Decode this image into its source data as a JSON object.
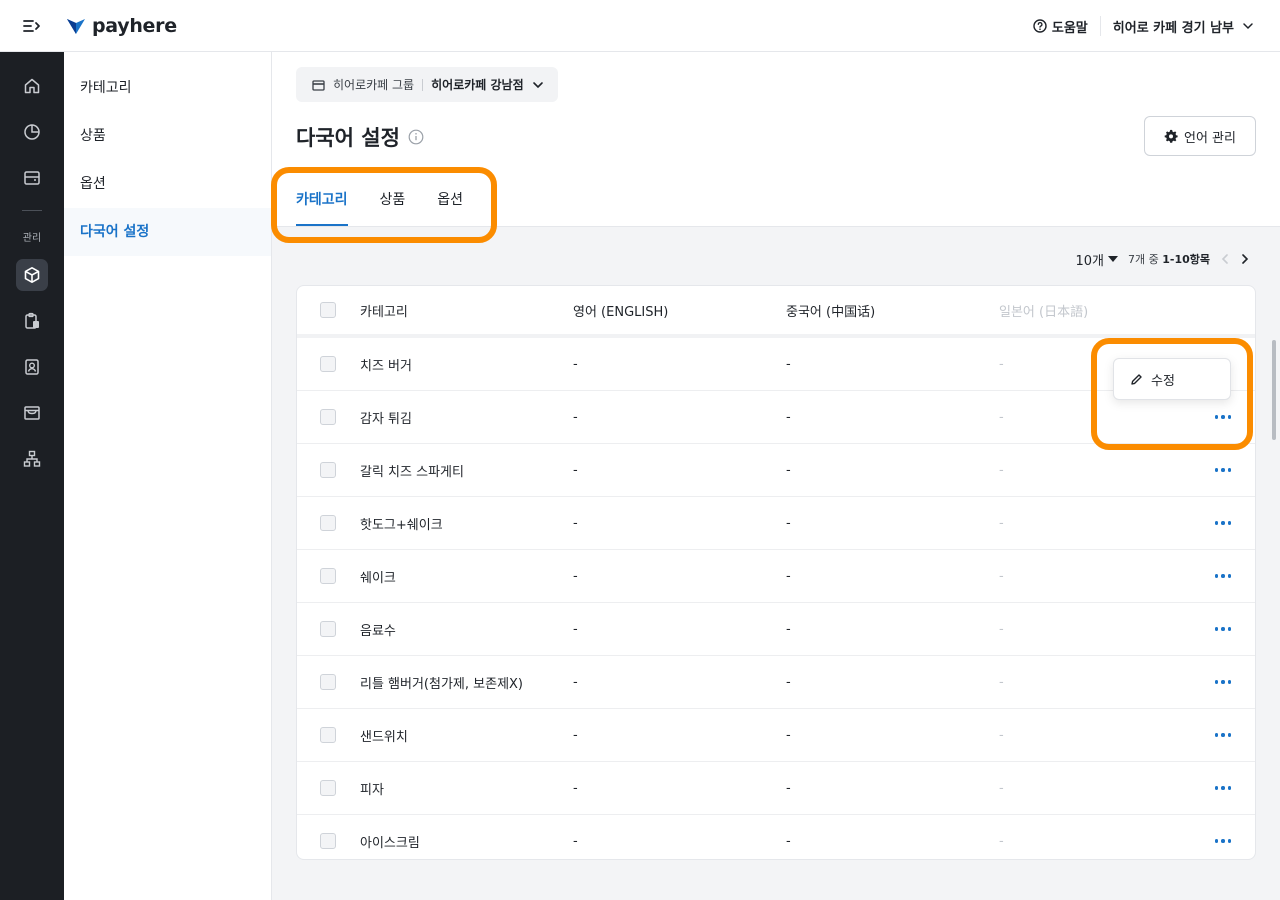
{
  "topbar": {
    "brand": "payhere",
    "help_label": "도움말",
    "store_label": "히어로 카페 경기 남부"
  },
  "rail": {
    "section_label": "관리"
  },
  "subnav": {
    "items": [
      {
        "label": "카테고리"
      },
      {
        "label": "상품"
      },
      {
        "label": "옵션"
      },
      {
        "label": "다국어 설정"
      }
    ]
  },
  "header": {
    "group": "히어로카페 그룹",
    "store": "히어로카페 강남점",
    "title": "다국어 설정",
    "lang_button": "언어 관리",
    "tabs": [
      {
        "label": "카테고리"
      },
      {
        "label": "상품"
      },
      {
        "label": "옵션"
      }
    ]
  },
  "pager": {
    "per_page": "10개",
    "total_prefix": "7개 중",
    "range": "1-10항목"
  },
  "table": {
    "columns": [
      "카테고리",
      "영어 (ENGLISH)",
      "중국어 (中国话)",
      "일본어 (日本語)"
    ],
    "rows": [
      {
        "name": "치즈 버거",
        "en": "-",
        "zh": "-",
        "ja": "-"
      },
      {
        "name": "감자 튀김",
        "en": "-",
        "zh": "-",
        "ja": "-"
      },
      {
        "name": "갈릭 치즈 스파게티",
        "en": "-",
        "zh": "-",
        "ja": "-"
      },
      {
        "name": "핫도그+쉐이크",
        "en": "-",
        "zh": "-",
        "ja": "-"
      },
      {
        "name": "쉐이크",
        "en": "-",
        "zh": "-",
        "ja": "-"
      },
      {
        "name": "음료수",
        "en": "-",
        "zh": "-",
        "ja": "-"
      },
      {
        "name": "리틀 햄버거(첨가제, 보존제X)",
        "en": "-",
        "zh": "-",
        "ja": "-"
      },
      {
        "name": "샌드위치",
        "en": "-",
        "zh": "-",
        "ja": "-"
      },
      {
        "name": "피자",
        "en": "-",
        "zh": "-",
        "ja": "-"
      },
      {
        "name": "아이스크림",
        "en": "-",
        "zh": "-",
        "ja": "-"
      }
    ]
  },
  "menu": {
    "edit_label": "수정"
  },
  "colors": {
    "accent": "#1a73c8",
    "highlight": "#fb8c00",
    "rail": "#1c1f24"
  }
}
